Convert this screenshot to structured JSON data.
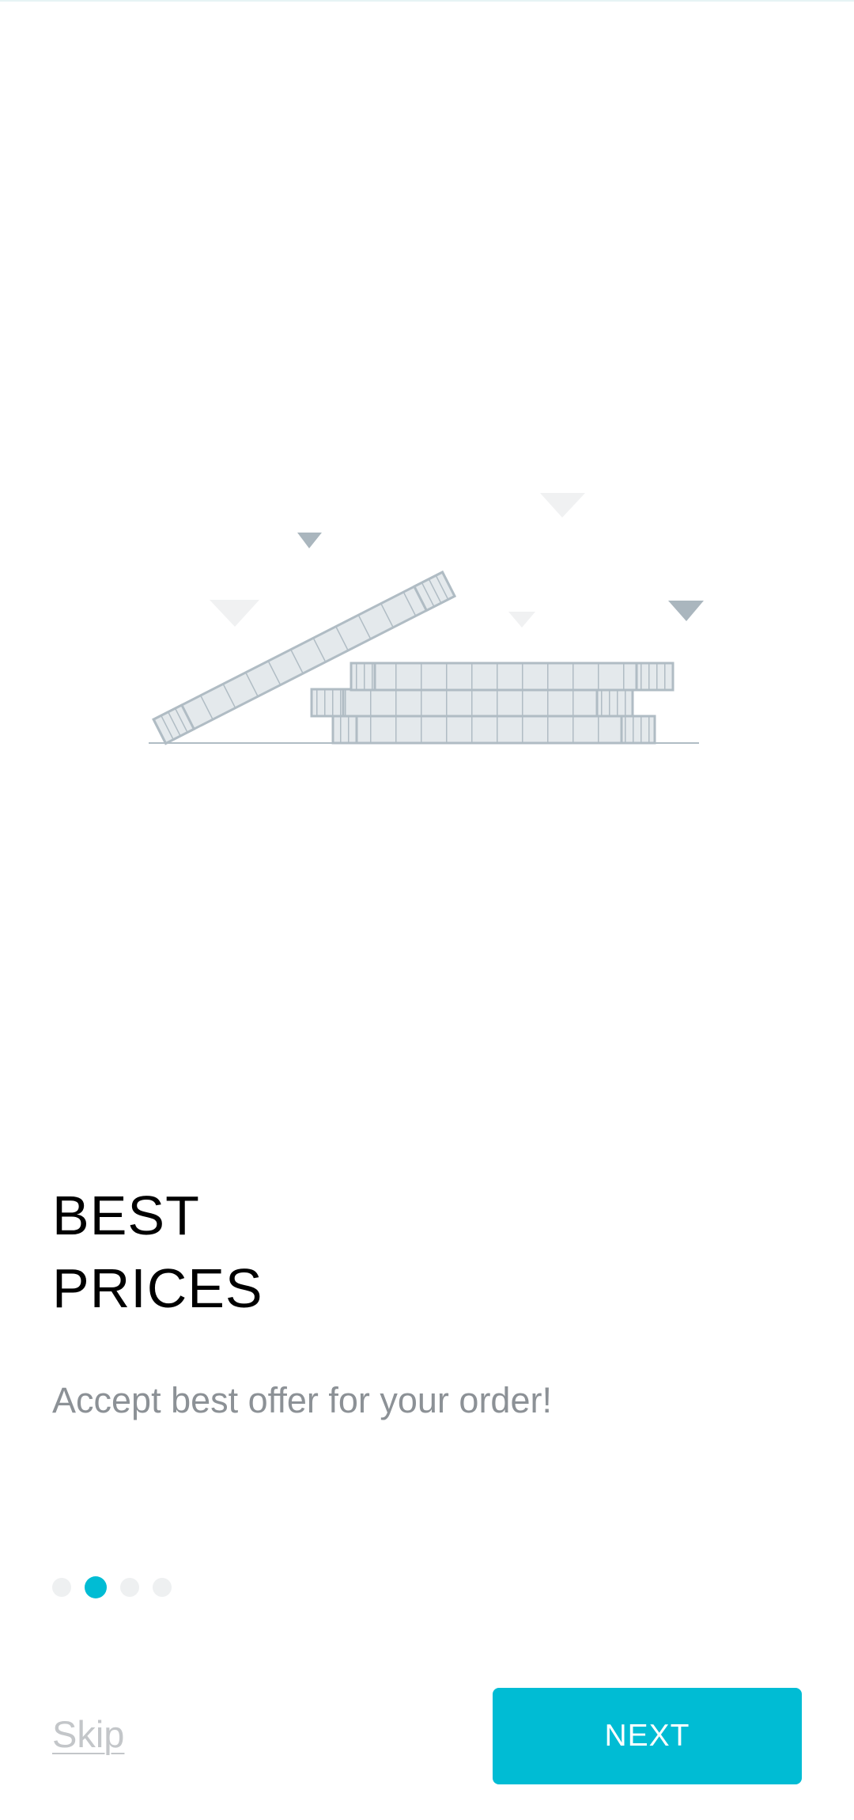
{
  "onboarding": {
    "title_line1": "BEST",
    "title_line2": "PRICES",
    "subtitle": "Accept best offer for your order!",
    "illustration": "coin-stack-illustration",
    "page_indicator": {
      "total_pages": 4,
      "current_page": 2
    }
  },
  "footer": {
    "skip_label": "Skip",
    "next_label": "NEXT"
  },
  "colors": {
    "accent": "#00bcd4",
    "title": "#000000",
    "subtitle": "#8c9196",
    "skip": "#c3c6c9",
    "dot_inactive": "#eef0f1",
    "coin_stroke": "#b0bcc4",
    "coin_fill": "#e4e9ec"
  }
}
